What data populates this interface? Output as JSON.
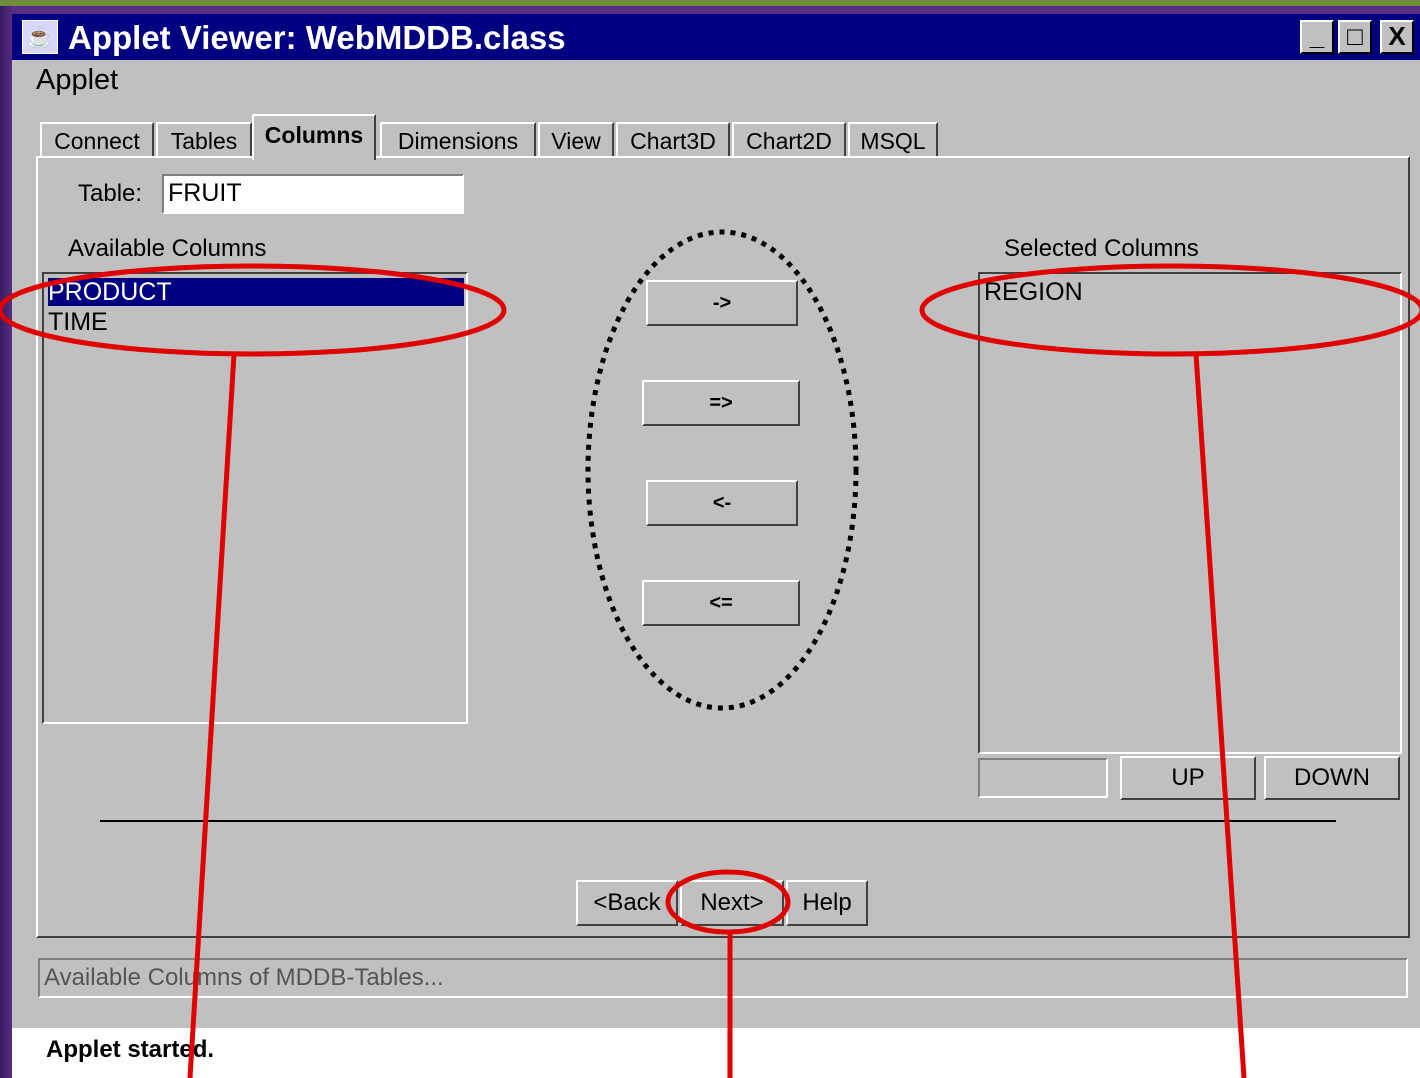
{
  "window": {
    "title": "Applet Viewer: WebMDDB.class",
    "minimize": "_",
    "maximize": "□",
    "close": "X"
  },
  "menu": {
    "applet": "Applet"
  },
  "tabs": [
    {
      "label": "Connect"
    },
    {
      "label": "Tables"
    },
    {
      "label": "Columns"
    },
    {
      "label": "Dimensions"
    },
    {
      "label": "View"
    },
    {
      "label": "Chart3D"
    },
    {
      "label": "Chart2D"
    },
    {
      "label": "MSQL"
    }
  ],
  "active_tab": "Columns",
  "table": {
    "label": "Table:",
    "value": "FRUIT"
  },
  "available": {
    "label": "Available Columns",
    "items": [
      "PRODUCT",
      "TIME"
    ],
    "selected": "PRODUCT"
  },
  "selected_columns": {
    "label": "Selected Columns",
    "items": [
      "REGION"
    ]
  },
  "move_buttons": {
    "add_one": "->",
    "add_all": "=>",
    "remove_one": "<-",
    "remove_all": "<="
  },
  "order_buttons": {
    "order_field": "",
    "up": "UP",
    "down": "DOWN"
  },
  "nav_buttons": {
    "back": "<Back",
    "next": "Next>",
    "help": "Help"
  },
  "status_text": "Available Columns of MDDB-Tables...",
  "applet_status": "Applet started.",
  "colors": {
    "background": "#5a2d82",
    "title_bar": "#000080",
    "panel": "#c0c0c0",
    "annotation": "#e00000"
  }
}
